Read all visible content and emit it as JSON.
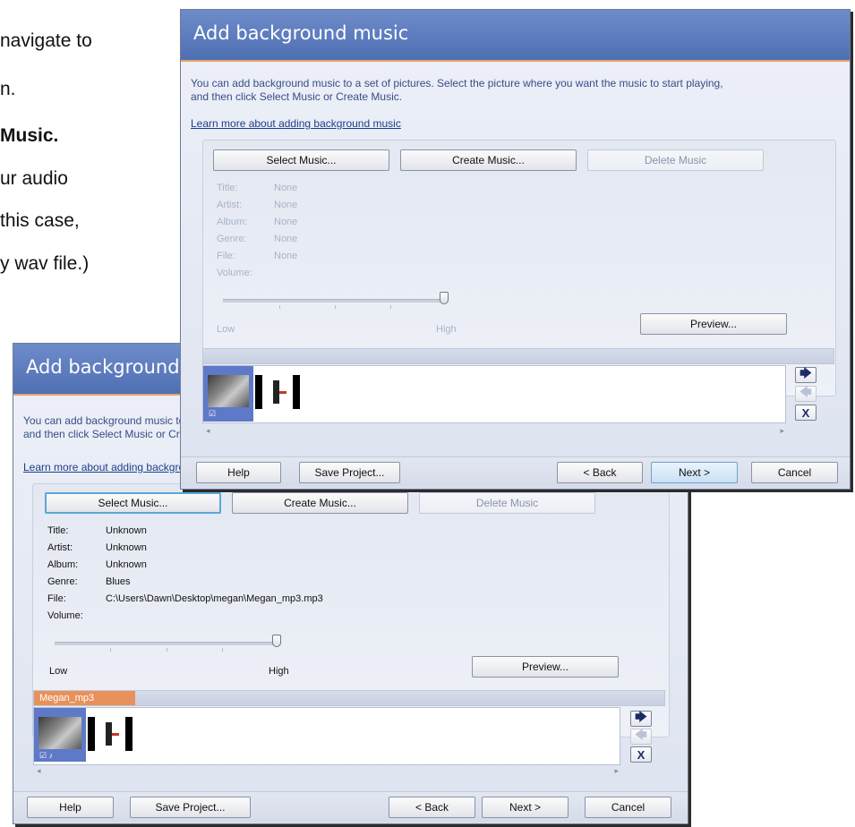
{
  "doc": {
    "lines": [
      "navigate to",
      "n.",
      "Music.",
      "ur audio",
      "this case,",
      "y wav file.)"
    ]
  },
  "dialog_front": {
    "title": "Add background music",
    "description_line1": "You can add background music to a set of pictures.  Select the picture where you want the music to start playing,",
    "description_line2": "and then click Select Music or Create Music.",
    "learn_link": "Learn more about adding background music",
    "select_music": "Select Music...",
    "create_music": "Create Music...",
    "delete_music": "Delete Music",
    "labels": {
      "title": "Title:",
      "artist": "Artist:",
      "album": "Album:",
      "genre": "Genre:",
      "file": "File:",
      "volume": "Volume:"
    },
    "values": {
      "title": "None",
      "artist": "None",
      "album": "None",
      "genre": "None",
      "file": "None"
    },
    "volume_level": 1.0,
    "low": "Low",
    "high": "High",
    "preview": "Preview...",
    "help": "Help",
    "save_project": "Save Project...",
    "back": "< Back",
    "next": "Next >",
    "cancel": "Cancel"
  },
  "dialog_back": {
    "title": "Add background music",
    "description_line1": "You can add background music to a set of pictures.  Select the picture where you want the music to start playing,",
    "description_line2": "and then click Select Music or Create Music.",
    "learn_link": "Learn more about adding background music",
    "select_music": "Select Music...",
    "create_music": "Create Music...",
    "delete_music": "Delete Music",
    "labels": {
      "title": "Title:",
      "artist": "Artist:",
      "album": "Album:",
      "genre": "Genre:",
      "file": "File:",
      "volume": "Volume:"
    },
    "values": {
      "title": "Unknown",
      "artist": "Unknown",
      "album": "Unknown",
      "genre": "Blues",
      "file": "C:\\Users\\Dawn\\Desktop\\megan\\Megan_mp3.mp3"
    },
    "volume_level": 1.0,
    "low": "Low",
    "high": "High",
    "preview": "Preview...",
    "music_tag": "Megan_mp3",
    "help": "Help",
    "save_project": "Save Project...",
    "back": "< Back",
    "next": "Next >",
    "cancel": "Cancel"
  },
  "side_buttons": {
    "right": "🡆",
    "left": "🡄",
    "remove": "X"
  },
  "scroll": {
    "left": "◂",
    "right": "▸"
  },
  "colors": {
    "header_blue": "#5a78bd",
    "accent_orange": "#e8915a",
    "link_blue": "#1d3d8a"
  }
}
